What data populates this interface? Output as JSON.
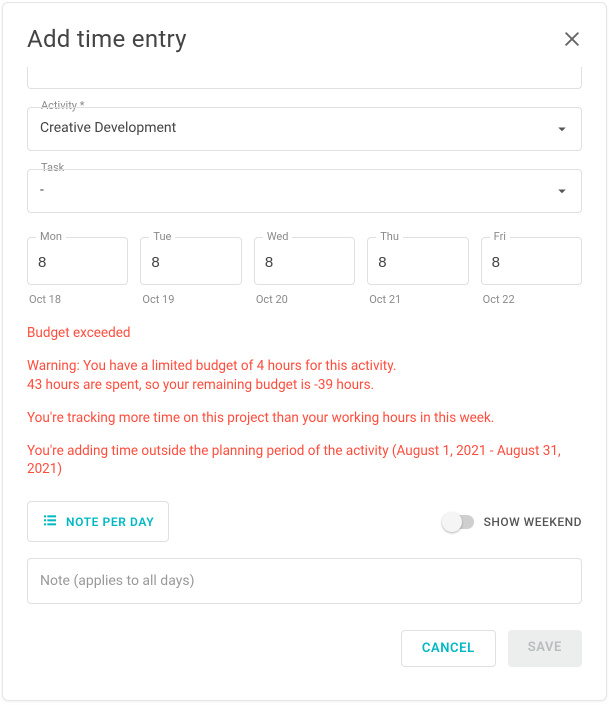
{
  "dialog": {
    "title": "Add time entry"
  },
  "activity": {
    "label": "Activity *",
    "value": "Creative Development"
  },
  "task": {
    "label": "Task",
    "value": "-"
  },
  "days": [
    {
      "short": "Mon",
      "value": "8",
      "date": "Oct 18"
    },
    {
      "short": "Tue",
      "value": "8",
      "date": "Oct 19"
    },
    {
      "short": "Wed",
      "value": "8",
      "date": "Oct 20"
    },
    {
      "short": "Thu",
      "value": "8",
      "date": "Oct 21"
    },
    {
      "short": "Fri",
      "value": "8",
      "date": "Oct 22"
    }
  ],
  "warnings": {
    "budget_exceeded": "Budget exceeded",
    "budget_detail": "Warning: You have a limited budget of 4 hours for this activity.\n43 hours are spent, so your remaining budget is -39 hours.",
    "over_hours": "You're tracking more time on this project than your working hours in this week.",
    "outside_period": "You're adding time outside the planning period of the activity (August 1, 2021 - August 31, 2021)"
  },
  "controls": {
    "note_per_day": "NOTE PER DAY",
    "show_weekend": "SHOW WEEKEND"
  },
  "note": {
    "placeholder": "Note (applies to all days)"
  },
  "buttons": {
    "cancel": "CANCEL",
    "save": "SAVE"
  },
  "colors": {
    "accent": "#00b8c4",
    "error": "#ff4d3d"
  }
}
